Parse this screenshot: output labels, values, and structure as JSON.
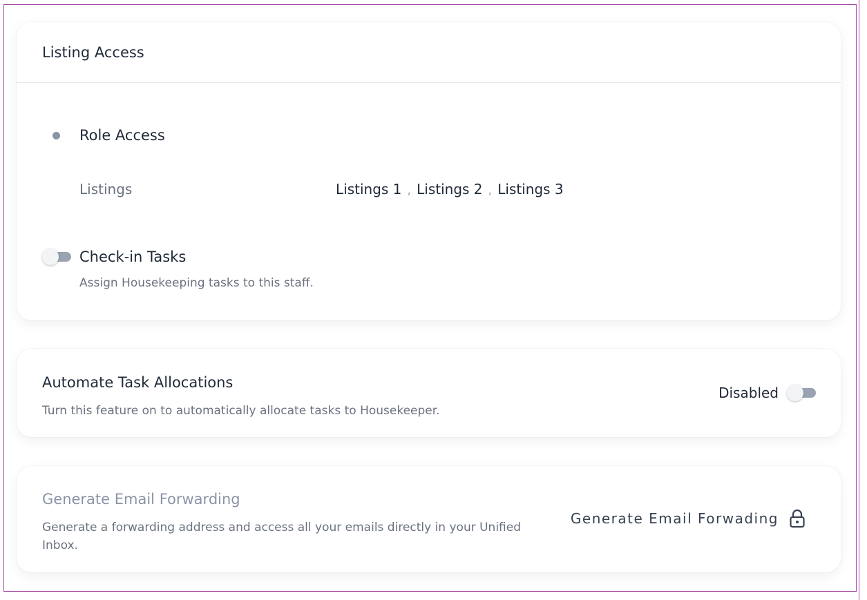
{
  "listing_access": {
    "header": "Listing Access",
    "role_label": "Role Access",
    "listings_label": "Listings",
    "listings": [
      "Listings 1",
      "Listings 2",
      "Listings 3"
    ],
    "separator": ",",
    "checkin": {
      "title": "Check-in Tasks",
      "description": "Assign Housekeeping tasks to this staff.",
      "enabled": false
    }
  },
  "automate": {
    "title": "Automate Task Allocations",
    "description": "Turn this feature on to automatically allocate tasks to Housekeeper.",
    "status": "Disabled",
    "enabled": false
  },
  "email_forwarding": {
    "title": "Generate Email Forwarding",
    "description": "Generate a forwarding address and access all your emails directly in your Unified Inbox.",
    "action_label": "Generate Email Forwading",
    "action_icon": "lock-icon"
  },
  "colors": {
    "muted_text": "#6b7280",
    "toggle_track": "#9aa3b2",
    "border": "#a64ca6"
  }
}
